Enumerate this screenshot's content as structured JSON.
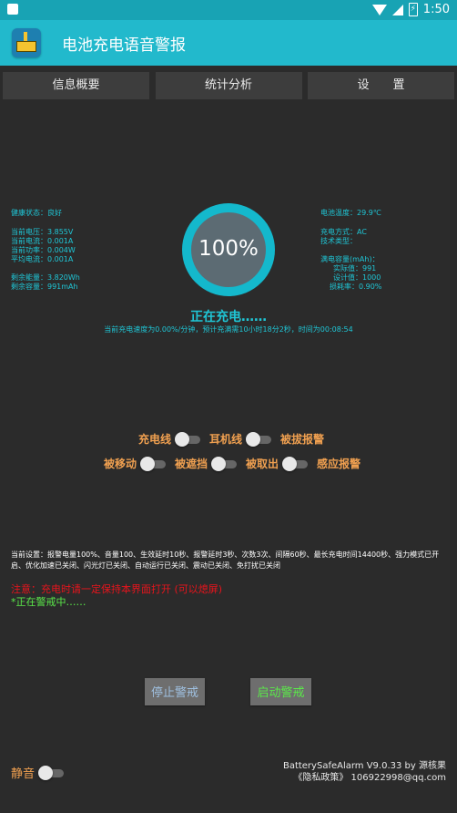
{
  "status_bar": {
    "time": "1:50",
    "battery_glyph": "⚡"
  },
  "app": {
    "title": "电池充电语音警报"
  },
  "tabs": [
    "信息概要",
    "统计分析",
    "设　　置"
  ],
  "left_info": {
    "health": "健康状态：良好",
    "voltage": "当前电压：3.855V",
    "current": "当前电流：0.001A",
    "power": "当前功率：0.004W",
    "avg_current": "平均电流：0.001A",
    "remaining_energy": "剩余能量：3.820Wh",
    "remaining_capacity": "剩余容量：991mAh"
  },
  "right_info": {
    "temperature": "电池温度：29.9℃",
    "charge_mode": "充电方式：AC",
    "tech_type": "技术类型：",
    "full_capacity": "满电容量(mAh)：",
    "actual": "实际值：991",
    "design": "设计值：1000",
    "wear": "损耗率：0.90%"
  },
  "gauge": {
    "percent_text": "100%",
    "level": 100
  },
  "charging": {
    "status": "正在充电……",
    "detail": "当前充电速度为0.00%/分钟，预计充满需10小时18分2秒，时间为00:08:54"
  },
  "toggles_row1": {
    "charger_cable": "充电线",
    "earphone": "耳机线",
    "unplug_alarm": "被拔报警"
  },
  "toggles_row2": {
    "moved": "被移动",
    "covered": "被遮挡",
    "taken_out": "被取出",
    "sensor_alarm": "感应报警"
  },
  "settings_text": "当前设置：报警电量100%、音量100、生效延时10秒、报警延时3秒、次数3次、间隔60秒、最长充电时间14400秒、强力模式已开启、优化加速已关闭、闪光灯已关闭、自动运行已关闭、震动已关闭、免打扰已关闭",
  "note": "注意：充电时请一定保持本界面打开 (可以熄屏)",
  "guard_status": "*正在警戒中……",
  "buttons": {
    "stop": "停止警戒",
    "start": "启动警戒"
  },
  "mute": {
    "label": "静音"
  },
  "footer": {
    "version": "BatterySafeAlarm V9.0.33 by 源核果",
    "privacy": "《隐私政策》  106922998@qq.com"
  },
  "colors": {
    "toolbar": "#22b9cc",
    "background": "#2b2b2b",
    "accent": "#1fc6d6",
    "label": "#f0a050",
    "warning": "#e8141c",
    "ok": "#5be84a"
  }
}
